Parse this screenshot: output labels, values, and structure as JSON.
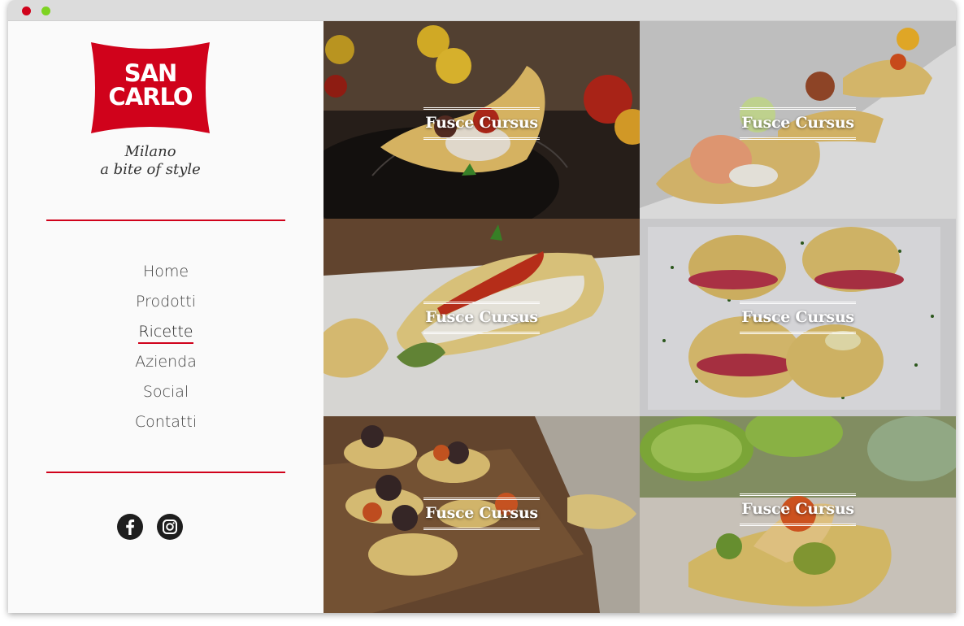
{
  "window": {
    "controls": [
      "close",
      "maximize"
    ]
  },
  "brand": {
    "logo_line1": "SAN",
    "logo_line2": "CARLO",
    "tagline_line1": "Milano",
    "tagline_line2": "a bite of style",
    "accent_color": "#d0021b"
  },
  "nav": {
    "items": [
      {
        "label": "Home",
        "active": false
      },
      {
        "label": "Prodotti",
        "active": false
      },
      {
        "label": "Ricette",
        "active": true
      },
      {
        "label": "Azienda",
        "active": false
      },
      {
        "label": "Social",
        "active": false
      },
      {
        "label": "Contatti",
        "active": false
      }
    ]
  },
  "social": {
    "icons": [
      "facebook-icon",
      "instagram-icon"
    ]
  },
  "recipes": [
    {
      "title": "Fusce Cursus"
    },
    {
      "title": "Fusce Cursus"
    },
    {
      "title": "Fusce Cursus"
    },
    {
      "title": "Fusce Cursus"
    },
    {
      "title": "Fusce Cursus"
    },
    {
      "title": "Fusce Cursus"
    }
  ]
}
